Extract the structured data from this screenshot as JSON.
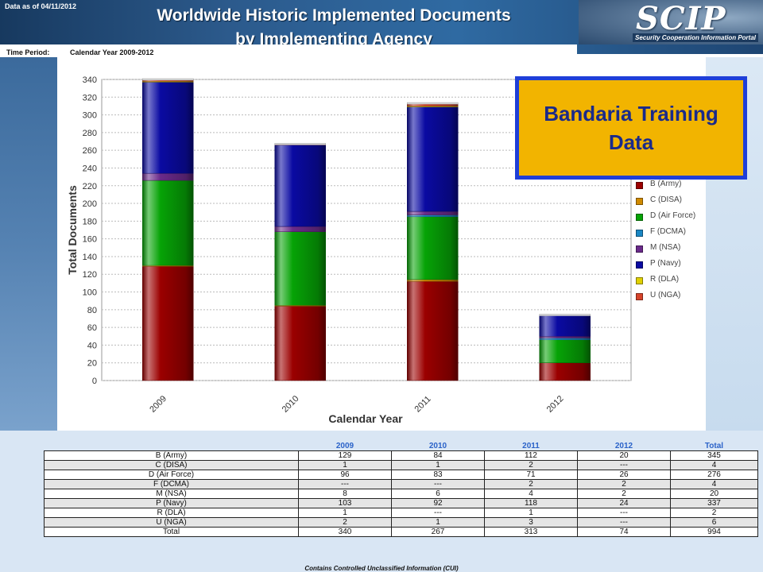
{
  "header": {
    "data_as_of": "Data as of 04/11/2012",
    "title_line1": "Worldwide Historic Implemented Documents",
    "title_line2": "by Implementing Agency",
    "logo_text": "SCIP",
    "logo_subtitle": "Security Cooperation Information Portal"
  },
  "period": {
    "label": "Time Period:",
    "value": "Calendar Year 2009-2012"
  },
  "callout": {
    "text": "Bandaria Training Data"
  },
  "colors": {
    "B": "#9b0000",
    "C": "#d08a00",
    "D": "#06a306",
    "F": "#1a87c4",
    "M": "#6a2a8a",
    "P": "#0a0aa2",
    "R": "#e0d000",
    "U": "#d6432a"
  },
  "chart_data": {
    "type": "bar",
    "stacked": true,
    "categories": [
      "2009",
      "2010",
      "2011",
      "2012"
    ],
    "xlabel": "Calendar Year",
    "ylabel": "Total Documents",
    "ylim": [
      0,
      340
    ],
    "yticks": [
      0,
      20,
      40,
      60,
      80,
      100,
      120,
      140,
      160,
      180,
      200,
      220,
      240,
      260,
      280,
      300,
      320,
      340
    ],
    "grid": true,
    "series": [
      {
        "key": "B",
        "name": "B (Army)",
        "values": [
          129,
          84,
          112,
          20
        ]
      },
      {
        "key": "C",
        "name": "C (DISA)",
        "values": [
          1,
          1,
          2,
          0
        ]
      },
      {
        "key": "D",
        "name": "D (Air Force)",
        "values": [
          96,
          83,
          71,
          26
        ]
      },
      {
        "key": "F",
        "name": "F (DCMA)",
        "values": [
          0,
          0,
          2,
          2
        ]
      },
      {
        "key": "M",
        "name": "M (NSA)",
        "values": [
          8,
          6,
          4,
          2
        ]
      },
      {
        "key": "P",
        "name": "P (Navy)",
        "values": [
          103,
          92,
          118,
          24
        ]
      },
      {
        "key": "R",
        "name": "R (DLA)",
        "values": [
          1,
          0,
          1,
          0
        ]
      },
      {
        "key": "U",
        "name": "U (NGA)",
        "values": [
          2,
          1,
          3,
          0
        ]
      }
    ]
  },
  "table": {
    "columns": [
      "",
      "2009",
      "2010",
      "2011",
      "2012",
      "Total"
    ],
    "rows": [
      [
        "B (Army)",
        "129",
        "84",
        "112",
        "20",
        "345"
      ],
      [
        "C (DISA)",
        "1",
        "1",
        "2",
        "---",
        "4"
      ],
      [
        "D (Air Force)",
        "96",
        "83",
        "71",
        "26",
        "276"
      ],
      [
        "F (DCMA)",
        "---",
        "---",
        "2",
        "2",
        "4"
      ],
      [
        "M (NSA)",
        "8",
        "6",
        "4",
        "2",
        "20"
      ],
      [
        "P (Navy)",
        "103",
        "92",
        "118",
        "24",
        "337"
      ],
      [
        "R (DLA)",
        "1",
        "---",
        "1",
        "---",
        "2"
      ],
      [
        "U (NGA)",
        "2",
        "1",
        "3",
        "---",
        "6"
      ],
      [
        "Total",
        "340",
        "267",
        "313",
        "74",
        "994"
      ]
    ]
  },
  "footer": {
    "note": "Contains Controlled Unclassified Information (CUI)"
  }
}
